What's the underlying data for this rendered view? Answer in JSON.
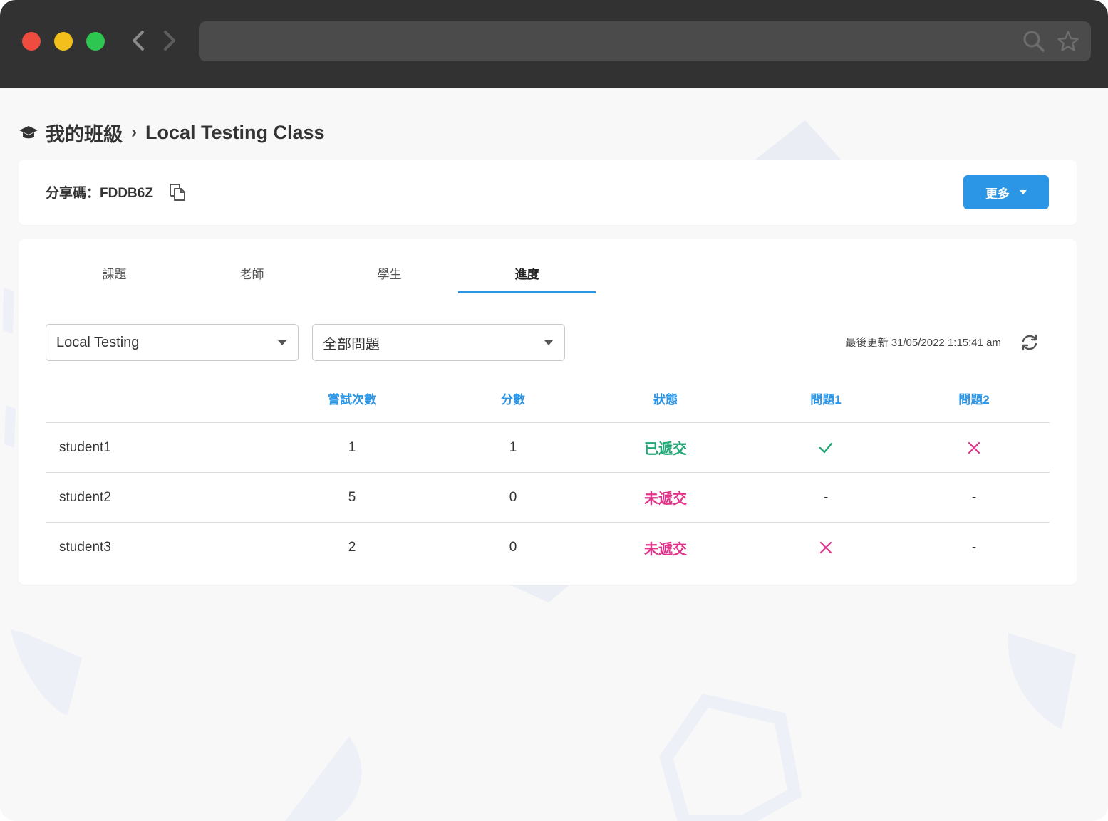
{
  "breadcrumb": {
    "root": "我的班級",
    "separator": "›",
    "current": "Local Testing Class"
  },
  "share": {
    "label": "分享碼：FDDB6Z"
  },
  "actions": {
    "more_label": "更多"
  },
  "tabs": [
    {
      "label": "課題",
      "active": false
    },
    {
      "label": "老師",
      "active": false
    },
    {
      "label": "學生",
      "active": false
    },
    {
      "label": "進度",
      "active": true
    }
  ],
  "filters": {
    "topic": "Local Testing",
    "question": "全部問題"
  },
  "last_updated": "最後更新 31/05/2022 1:15:41 am",
  "table": {
    "headers": [
      "",
      "嘗試次數",
      "分數",
      "狀態",
      "問題1",
      "問題2"
    ],
    "rows": [
      {
        "name": "student1",
        "attempts": "1",
        "score": "1",
        "status": "已遞交",
        "status_type": "submitted",
        "q1": "check",
        "q2": "cross"
      },
      {
        "name": "student2",
        "attempts": "5",
        "score": "0",
        "status": "未遞交",
        "status_type": "pending",
        "q1": "-",
        "q2": "-"
      },
      {
        "name": "student3",
        "attempts": "2",
        "score": "0",
        "status": "未遞交",
        "status_type": "pending",
        "q1": "cross",
        "q2": "-"
      }
    ]
  },
  "colors": {
    "accent": "#2b95e6",
    "success": "#21a675",
    "danger": "#e2338a",
    "chrome": "#323232"
  },
  "icons": {
    "breadcrumb": "graduation-cap-icon",
    "copy": "copy-icon",
    "refresh": "refresh-icon",
    "search": "search-icon",
    "star": "star-icon"
  }
}
